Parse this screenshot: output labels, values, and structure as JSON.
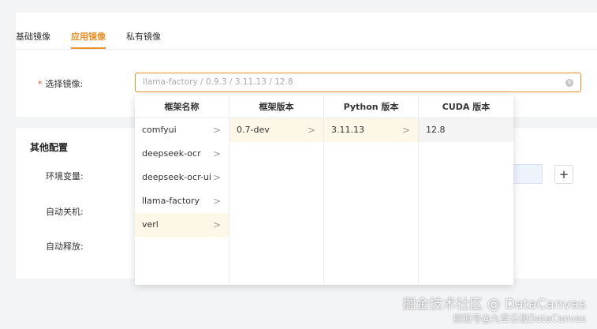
{
  "tabs": [
    {
      "label": "基础镜像",
      "active": false
    },
    {
      "label": "应用镜像",
      "active": true
    },
    {
      "label": "私有镜像",
      "active": false
    }
  ],
  "image_field": {
    "required_mark": "*",
    "label": "选择镜像:",
    "value": "llama-factory / 0.9.3 / 3.11.13 / 12.8"
  },
  "other_config": {
    "title": "其他配置",
    "env_label": "环境变量:",
    "auto_shutdown_label": "自动关机:",
    "auto_release_label": "自动释放:",
    "add_symbol": "+"
  },
  "cascader": {
    "columns": [
      {
        "header": "框架名称",
        "options": [
          "comfyui",
          "deepseek-ocr",
          "deepseek-ocr-ui",
          "llama-factory",
          "verl"
        ],
        "selected": 4
      },
      {
        "header": "框架版本",
        "options": [
          "0.7-dev"
        ],
        "selected": 0
      },
      {
        "header": "Python 版本",
        "options": [
          "3.11.13"
        ],
        "selected": 0
      },
      {
        "header": "CUDA 版本",
        "options": [
          "12.8"
        ],
        "selected": 0
      }
    ]
  },
  "watermark": {
    "line1": "掘金技术社区 @ DataCanvas",
    "line2": "搜狐号@九章云极DataCanvas"
  },
  "colors": {
    "accent": "#e8912a",
    "required": "#e54d42"
  }
}
